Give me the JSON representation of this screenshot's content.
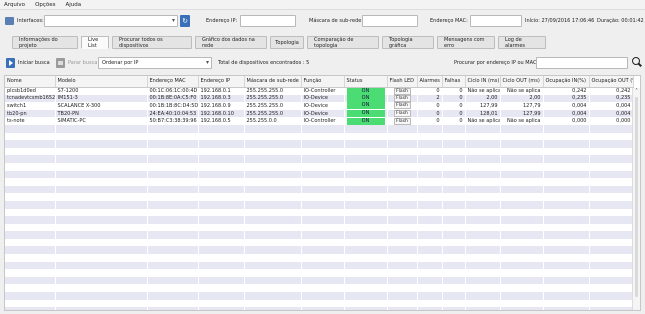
{
  "menu": [
    "Arquivo",
    "Opções",
    "Ajuda"
  ],
  "top": {
    "interfaces_label": "Interfaces:",
    "interfaces_value": "",
    "ip_label": "Endereço IP:",
    "ip_value": "",
    "mask_label": "Máscara de sub-rede:",
    "mask_value": "",
    "mac_label": "Endereço MAC:",
    "mac_value": "",
    "start_label": "Início: 27/09/2016 17:06:46",
    "duration_label": "Duração: 00:01:42"
  },
  "tabs": [
    "Informações do projeto",
    "Live List",
    "Procurar todos os dispositivos",
    "Gráfico dos dados na rede",
    "Topologia",
    "Comparação de topologia",
    "Topologia gráfica",
    "Mensagens com erro",
    "Log de alarmes"
  ],
  "toolbar": {
    "start_search": "Iniciar busca",
    "stop_search": "Parar busca",
    "sort_value": "Ordenar por IP",
    "found_label": "Total de dispositivos encontrados : 5",
    "search_ip_mac_label": "Procurar por endereço IP ou MAC :",
    "search_ip_mac_value": ""
  },
  "table": {
    "columns": [
      "Nome",
      "Modelo",
      "Endereço MAC",
      "Endereço IP",
      "Máscara de sub-rede",
      "Função",
      "Status",
      "Flash LED",
      "Alarmes",
      "Falhas",
      "Ciclo IN (ms)",
      "Ciclo OUT (ms)",
      "Ocupação IN(%)",
      "Ocupação OUT (%)"
    ],
    "rows": [
      [
        "plcsb1d0ed",
        "S7-1200",
        "00:1C:06:1C:00:4D",
        "192.168.0.1",
        "255.255.255.0",
        "IO-Controller",
        "ON",
        "Flash",
        "0",
        "0",
        "Não se aplica",
        "Não se aplica",
        "0,242",
        "0,242"
      ],
      [
        "tcnadevtcsmb1652a",
        "IM151-3",
        "00:1B:8E:0A:C5:F0",
        "192.168.0.3",
        "255.255.255.0",
        "IO-Device",
        "ON",
        "Flash",
        "2",
        "0",
        "2,00",
        "2,00",
        "0,235",
        "0,235"
      ],
      [
        "switch1",
        "SCALANCE X-300",
        "00:1B:1B:8C:D4:5D",
        "192.168.0.9",
        "255.255.255.0",
        "IO-Device",
        "ON",
        "Flash",
        "0",
        "0",
        "127,99",
        "127,79",
        "0,004",
        "0,004"
      ],
      [
        "tb20-pn",
        "TB20-PN",
        "24:EA:40:10:04:53",
        "192.168.0.10",
        "255.255.255.0",
        "IO-Device",
        "ON",
        "Flash",
        "0",
        "0",
        "128,01",
        "127,99",
        "0,004",
        "0,004"
      ],
      [
        "ts-note",
        "SIMATIC-PC",
        "50:B7:C3:38:39:96",
        "192.168.0.5",
        "255.255.0.0",
        "IO-Controller",
        "ON",
        "Flash",
        "0",
        "0",
        "Não se aplica",
        "Não se aplica",
        "0,000",
        "0,000"
      ]
    ],
    "empty_rows": 25
  },
  "colors": {
    "status_on": "#4bdc74",
    "accent": "#3a6fb9",
    "row_alt": "#e7e7f3"
  },
  "icons": [
    "interfaces-icon",
    "refresh-icon",
    "play-icon",
    "stop-icon",
    "search-icon",
    "chevron-up-icon"
  ]
}
